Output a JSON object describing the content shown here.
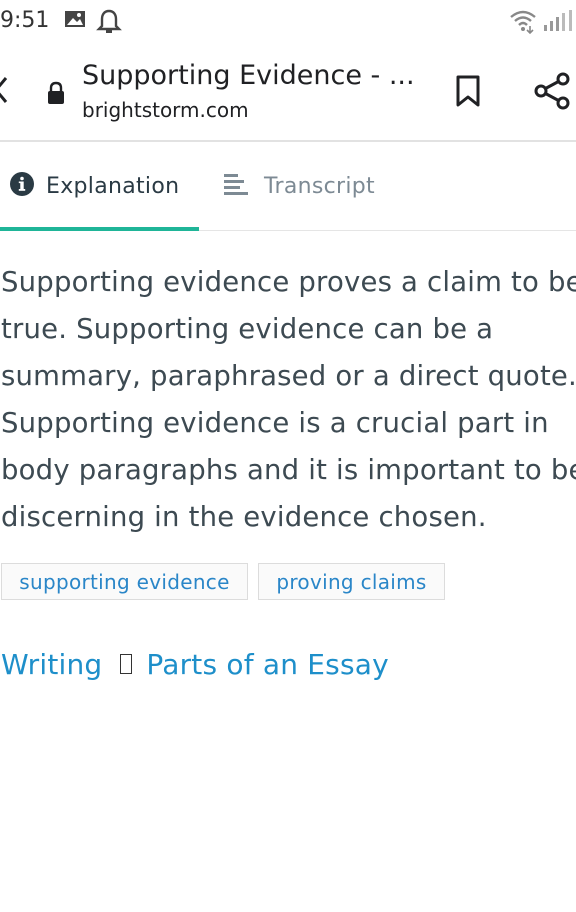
{
  "status_bar": {
    "time": "9:51",
    "icons": [
      "image-icon",
      "bell-icon",
      "wifi-icon",
      "signal-icon"
    ]
  },
  "toolbar": {
    "title": "Supporting Evidence - ...",
    "domain": "brightstorm.com",
    "icons": [
      "back-icon",
      "lock-icon",
      "bookmark-icon",
      "share-icon"
    ]
  },
  "tabs": [
    {
      "label": "Explanation",
      "icon": "info-icon",
      "active": true
    },
    {
      "label": "Transcript",
      "icon": "transcript-icon",
      "active": false
    }
  ],
  "content": {
    "lines": [
      "Supporting evidence proves a claim to be",
      "true. Supporting evidence can be a",
      "summary, paraphrased or a direct quote.",
      "Supporting evidence is a crucial part in",
      "body paragraphs and it is important to be",
      "discerning in the evidence chosen."
    ]
  },
  "tags": [
    "supporting evidence",
    "proving claims"
  ],
  "breadcrumb": {
    "items": [
      "Writing",
      "Parts of an Essay"
    ],
    "separator": "chevron-right-icon"
  },
  "colors": {
    "accent": "#1fb598",
    "link": "#1e8fca",
    "text": "#3d4a52"
  }
}
